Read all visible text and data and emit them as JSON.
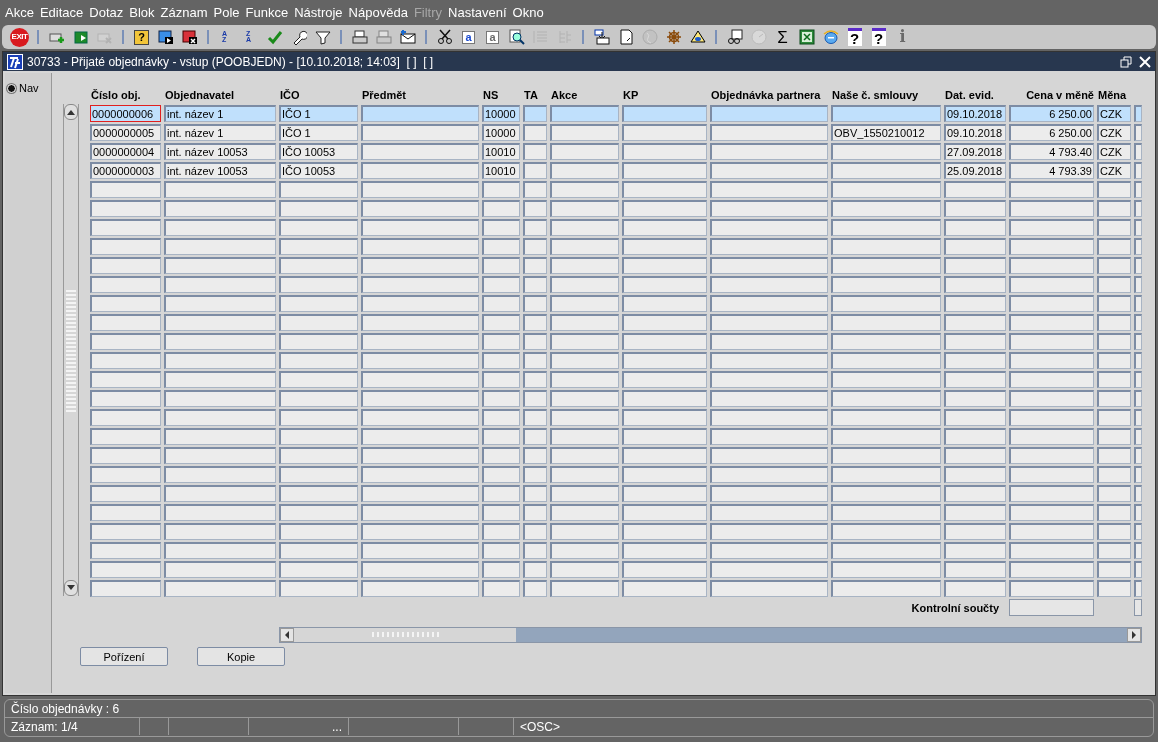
{
  "menu": [
    {
      "label": "Akce",
      "disabled": false
    },
    {
      "label": "Editace",
      "disabled": false
    },
    {
      "label": "Dotaz",
      "disabled": false
    },
    {
      "label": "Blok",
      "disabled": false
    },
    {
      "label": "Záznam",
      "disabled": false
    },
    {
      "label": "Pole",
      "disabled": false
    },
    {
      "label": "Funkce",
      "disabled": false
    },
    {
      "label": "Nástroje",
      "disabled": false
    },
    {
      "label": "Nápověda",
      "disabled": false
    },
    {
      "label": "Filtry",
      "disabled": true
    },
    {
      "label": "Nastavení",
      "disabled": false
    },
    {
      "label": "Okno",
      "disabled": false
    }
  ],
  "toolbar": [
    {
      "kind": "exit",
      "glyph": "EXIT",
      "disabled": false
    },
    {
      "kind": "separator"
    },
    {
      "kind": "insert",
      "disabled": false
    },
    {
      "kind": "next",
      "disabled": false
    },
    {
      "kind": "delete",
      "disabled": true
    },
    {
      "kind": "separator"
    },
    {
      "kind": "query",
      "glyph": "?",
      "disabled": false
    },
    {
      "kind": "execute",
      "disabled": false
    },
    {
      "kind": "cancel",
      "disabled": false
    },
    {
      "kind": "separator"
    },
    {
      "kind": "sort",
      "glyph": "AZ",
      "disabled": false
    },
    {
      "kind": "sort",
      "glyph": "ZA",
      "disabled": false
    },
    {
      "kind": "check",
      "disabled": false
    },
    {
      "kind": "wrench",
      "disabled": false
    },
    {
      "kind": "filter",
      "disabled": false
    },
    {
      "kind": "separator"
    },
    {
      "kind": "print",
      "disabled": false
    },
    {
      "kind": "print",
      "disabled": true
    },
    {
      "kind": "mail",
      "disabled": false
    },
    {
      "kind": "separator"
    },
    {
      "kind": "scissors",
      "disabled": false
    },
    {
      "kind": "copy",
      "glyph": "a",
      "disabled": false
    },
    {
      "kind": "copy",
      "glyph": "a",
      "disabled": true
    },
    {
      "kind": "magnifier",
      "disabled": false
    },
    {
      "kind": "list",
      "disabled": true
    },
    {
      "kind": "tree",
      "disabled": true
    },
    {
      "kind": "separator"
    },
    {
      "kind": "import",
      "disabled": false
    },
    {
      "kind": "document",
      "disabled": false
    },
    {
      "kind": "globe",
      "disabled": true
    },
    {
      "kind": "wheel",
      "disabled": false
    },
    {
      "kind": "eye",
      "disabled": false
    },
    {
      "kind": "separator"
    },
    {
      "kind": "glasses",
      "disabled": false
    },
    {
      "kind": "clock",
      "disabled": true
    },
    {
      "kind": "sigma",
      "glyph": "Σ",
      "disabled": false
    },
    {
      "kind": "sheet",
      "disabled": false
    },
    {
      "kind": "browser",
      "disabled": false
    },
    {
      "kind": "help",
      "glyph": "?",
      "disabled": false
    },
    {
      "kind": "help",
      "glyph": "?",
      "disabled": false
    },
    {
      "kind": "info",
      "glyph": "i",
      "disabled": true
    }
  ],
  "window": {
    "title": "30733 - Přijaté objednávky - vstup (POOBJEDN) - [10.10.2018; 14:03]  [ ]  [ ]"
  },
  "nav": {
    "label": "Nav",
    "selected": true
  },
  "table": {
    "columns": [
      {
        "label": "Číslo obj.",
        "kind": "text"
      },
      {
        "label": "Objednavatel",
        "kind": "text"
      },
      {
        "label": "IČO",
        "kind": "text"
      },
      {
        "label": "Předmět",
        "kind": "text"
      },
      {
        "label": "NS",
        "kind": "text"
      },
      {
        "label": "TA",
        "kind": "text"
      },
      {
        "label": "Akce",
        "kind": "text"
      },
      {
        "label": "KP",
        "kind": "text"
      },
      {
        "label": "Objednávka partnera",
        "kind": "text"
      },
      {
        "label": "Naše č. smlouvy",
        "kind": "text"
      },
      {
        "label": "Dat. evid.",
        "kind": "text"
      },
      {
        "label": "Cena v měně",
        "kind": "amount"
      },
      {
        "label": "Měna",
        "kind": "text"
      }
    ],
    "rows": [
      {
        "selected": true,
        "focused": true,
        "cells": [
          "0000000006",
          "int. název 1",
          "IČO 1",
          null,
          "10000",
          null,
          null,
          null,
          null,
          null,
          "09.10.2018",
          "6 250.00",
          "CZK"
        ]
      },
      {
        "selected": false,
        "focused": false,
        "cells": [
          "0000000005",
          "int. název 1",
          "IČO 1",
          null,
          "10000",
          null,
          null,
          null,
          null,
          "OBV_1550210012",
          "09.10.2018",
          "6 250.00",
          "CZK"
        ]
      },
      {
        "selected": false,
        "focused": false,
        "cells": [
          "0000000004",
          "int. název 10053",
          "IČO 10053",
          null,
          "10010",
          null,
          null,
          null,
          null,
          null,
          "27.09.2018",
          "4 793.40",
          "CZK"
        ]
      },
      {
        "selected": false,
        "focused": false,
        "cells": [
          "0000000003",
          "int. název 10053",
          "IČO 10053",
          null,
          "10010",
          null,
          null,
          null,
          null,
          null,
          "25.09.2018",
          "4 793.39",
          "CZK"
        ]
      }
    ],
    "totals_label": "Kontrolní součty"
  },
  "buttons": [
    "Pořízení",
    "Kopie"
  ],
  "status_bar": {
    "message": "Číslo objednávky : 6",
    "record": "Záznam: 1/4",
    "ellipsis": "...",
    "mode": "<OSC>"
  }
}
